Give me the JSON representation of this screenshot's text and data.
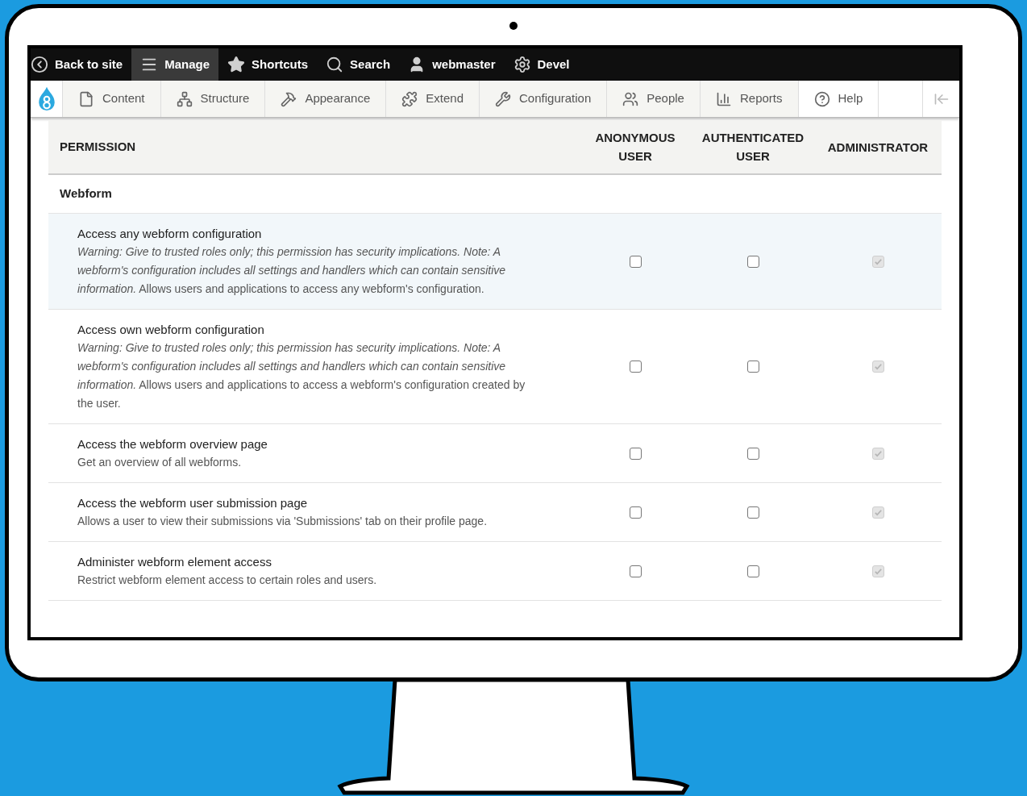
{
  "toolbar": {
    "items": [
      {
        "label": "Back to site",
        "selected": false
      },
      {
        "label": "Manage",
        "selected": true
      },
      {
        "label": "Shortcuts",
        "selected": false
      },
      {
        "label": "Search",
        "selected": false
      },
      {
        "label": "webmaster",
        "selected": false
      },
      {
        "label": "Devel",
        "selected": false
      }
    ]
  },
  "tray": {
    "items": [
      {
        "label": "Content",
        "selected": false
      },
      {
        "label": "Structure",
        "selected": false
      },
      {
        "label": "Appearance",
        "selected": false
      },
      {
        "label": "Extend",
        "selected": false
      },
      {
        "label": "Configuration",
        "selected": false
      },
      {
        "label": "People",
        "selected": false
      },
      {
        "label": "Reports",
        "selected": false
      },
      {
        "label": "Help",
        "selected": true
      }
    ]
  },
  "table": {
    "columns": [
      "PERMISSION",
      "ANONYMOUS USER",
      "AUTHENTICATED USER",
      "ADMINISTRATOR"
    ],
    "group": "Webform",
    "rows": [
      {
        "title": "Access any webform configuration",
        "description": "*Warning: Give to trusted roles only; this permission has security implications. Note: A webform's configuration includes all settings and handlers which can contain sensitive information.* Allows users and applications to access any webform's configuration.",
        "highlighted": true,
        "cells": [
          {
            "checked": false,
            "disabled": false
          },
          {
            "checked": false,
            "disabled": false
          },
          {
            "checked": true,
            "disabled": true
          }
        ]
      },
      {
        "title": "Access own webform configuration",
        "description": "*Warning: Give to trusted roles only; this permission has security implications. Note: A webform's configuration includes all settings and handlers which can contain sensitive information.* Allows users and applications to access a webform's configuration created by the user.",
        "highlighted": false,
        "cells": [
          {
            "checked": false,
            "disabled": false
          },
          {
            "checked": false,
            "disabled": false
          },
          {
            "checked": true,
            "disabled": true
          }
        ]
      },
      {
        "title": "Access the webform overview page",
        "description": "Get an overview of all webforms.",
        "highlighted": false,
        "cells": [
          {
            "checked": false,
            "disabled": false
          },
          {
            "checked": false,
            "disabled": false
          },
          {
            "checked": true,
            "disabled": true
          }
        ]
      },
      {
        "title": "Access the webform user submission page",
        "description": "Allows a user to view their submissions via 'Submissions' tab on their profile page.",
        "highlighted": false,
        "cells": [
          {
            "checked": false,
            "disabled": false
          },
          {
            "checked": false,
            "disabled": false
          },
          {
            "checked": true,
            "disabled": true
          }
        ]
      },
      {
        "title": "Administer webform element access",
        "description": "Restrict webform element access to certain roles and users.",
        "highlighted": false,
        "cells": [
          {
            "checked": false,
            "disabled": false
          },
          {
            "checked": false,
            "disabled": false
          },
          {
            "checked": true,
            "disabled": true
          }
        ]
      }
    ]
  }
}
